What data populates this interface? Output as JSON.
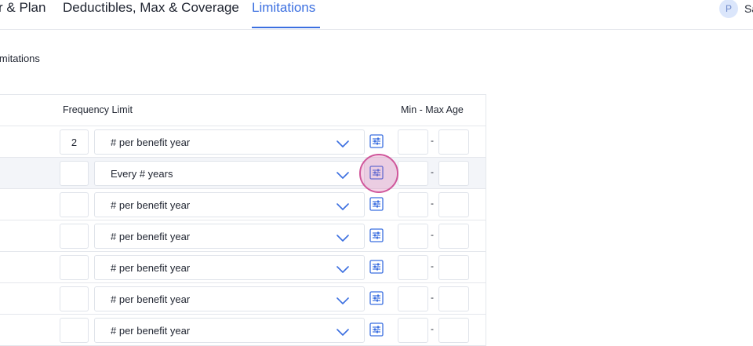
{
  "tabs": [
    {
      "label": "r & Plan"
    },
    {
      "label": "Deductibles, Max & Coverage"
    },
    {
      "label": "Limitations",
      "active": true
    }
  ],
  "user": {
    "initial": "P",
    "name": "Sa"
  },
  "section": {
    "title": "imitations"
  },
  "table": {
    "headers": {
      "frequency": "Frequency Limit",
      "age": "Min - Max Age"
    },
    "rows": [
      {
        "count": "2",
        "frequency": "# per benefit year",
        "age_min": "",
        "age_max": "",
        "dash": "-"
      },
      {
        "count": "",
        "frequency": "Every # years",
        "age_min": "",
        "age_max": "",
        "dash": "-"
      },
      {
        "count": "",
        "frequency": "# per benefit year",
        "age_min": "",
        "age_max": "",
        "dash": "-"
      },
      {
        "count": "",
        "frequency": "# per benefit year",
        "age_min": "",
        "age_max": "",
        "dash": "-"
      },
      {
        "count": "",
        "frequency": "# per benefit year",
        "age_min": "",
        "age_max": "",
        "dash": "-"
      },
      {
        "count": "",
        "frequency": "# per benefit year",
        "age_min": "",
        "age_max": "",
        "dash": "-"
      },
      {
        "count": "",
        "frequency": "# per benefit year",
        "age_min": "",
        "age_max": "",
        "dash": "-"
      }
    ]
  },
  "icons": {
    "chevron": "chevron-down-icon",
    "advanced": "sliders-icon"
  },
  "colors": {
    "accent": "#3b6fe0",
    "click_highlight": "#d0579b",
    "border": "#e4e7ec"
  }
}
